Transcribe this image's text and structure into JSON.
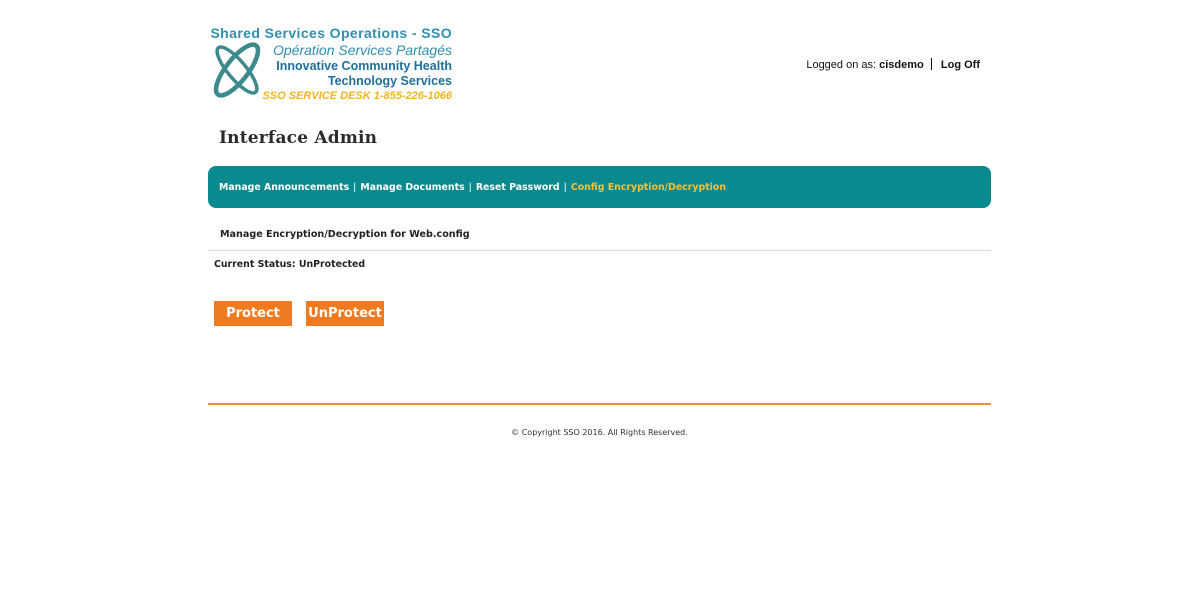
{
  "logo": {
    "line1": "Shared  Services  Operations  - SSO",
    "line2": "Opération  Services Partagés",
    "line3": "Innovative Community Health",
    "line4": "Technology Services",
    "line5": "SSO SERVICE DESK 1-855-226-1066",
    "mark_icon": "orbit-logo-icon",
    "colors": {
      "primary": "#2f8fb0",
      "accent": "#f2b51c",
      "mark": "#3d8a8c"
    }
  },
  "user": {
    "logged_label": "Logged on as:",
    "username": "cisdemo",
    "logoff_label": "Log Off"
  },
  "page": {
    "title": "Interface Admin"
  },
  "nav": {
    "items": [
      {
        "label": "Manage Announcements",
        "active": false
      },
      {
        "label": "Manage Documents",
        "active": false
      },
      {
        "label": "Reset Password",
        "active": false
      },
      {
        "label": "Config Encryption/Decryption",
        "active": true
      }
    ],
    "separator": "|",
    "colors": {
      "background": "#0a8a8f",
      "active": "#f3c13a"
    }
  },
  "main": {
    "section_title": "Manage Encryption/Decryption for Web.config",
    "status_text": "Current Status: UnProtected",
    "protect_label": "Protect",
    "unprotect_label": "UnProtect",
    "button_color": "#f07a20"
  },
  "footer": {
    "copyright": "© Copyright SSO 2016. All Rights Reserved."
  }
}
